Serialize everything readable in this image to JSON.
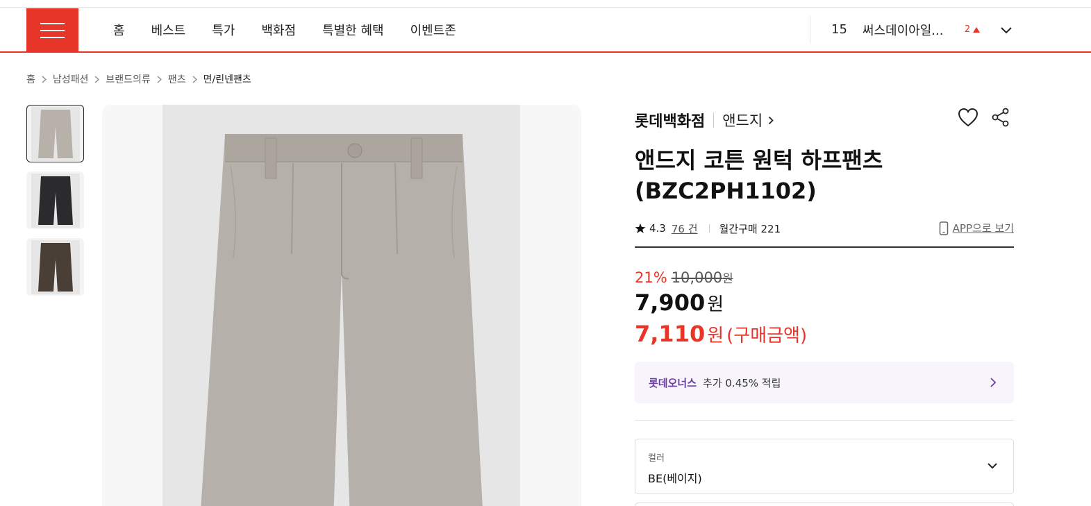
{
  "header": {
    "nav": [
      "홈",
      "베스트",
      "특가",
      "백화점",
      "특별한 혜택",
      "이벤트존"
    ],
    "rank": {
      "number": "15",
      "keyword": "써스데이아일...",
      "change": "2"
    }
  },
  "breadcrumb": [
    "홈",
    "남성패션",
    "브랜드의류",
    "팬츠",
    "면/린넨팬츠"
  ],
  "product": {
    "brand": "롯데백화점",
    "sub_brand": "앤드지",
    "title": "앤드지 코튼 원턱 하프팬츠 (BZC2PH1102)",
    "rating": "4.3",
    "review_count": "76 건",
    "monthly_sales": "월간구매 221",
    "app_link": "APP으로 보기",
    "discount_rate": "21%",
    "original_price": "10,000",
    "original_unit": "원",
    "price": "7,900",
    "price_unit": "원",
    "final_price": "7,110",
    "final_unit": "원",
    "final_note": "(구매금액)",
    "bonus": {
      "name": "롯데오너스",
      "text": "추가 0.45% 적립"
    },
    "option": {
      "label": "컬러",
      "value": "BE(베이지)"
    }
  },
  "thumbnails": [
    {
      "color_name": "beige",
      "color": "#b7b1aa"
    },
    {
      "color_name": "black",
      "color": "#2b2b2d"
    },
    {
      "color_name": "brown",
      "color": "#4a3f36"
    }
  ],
  "main_image": {
    "color_name": "beige",
    "color": "#b5b0aa"
  },
  "colors": {
    "accent": "#e8352a",
    "bonus_purple": "#6b3fa0"
  }
}
